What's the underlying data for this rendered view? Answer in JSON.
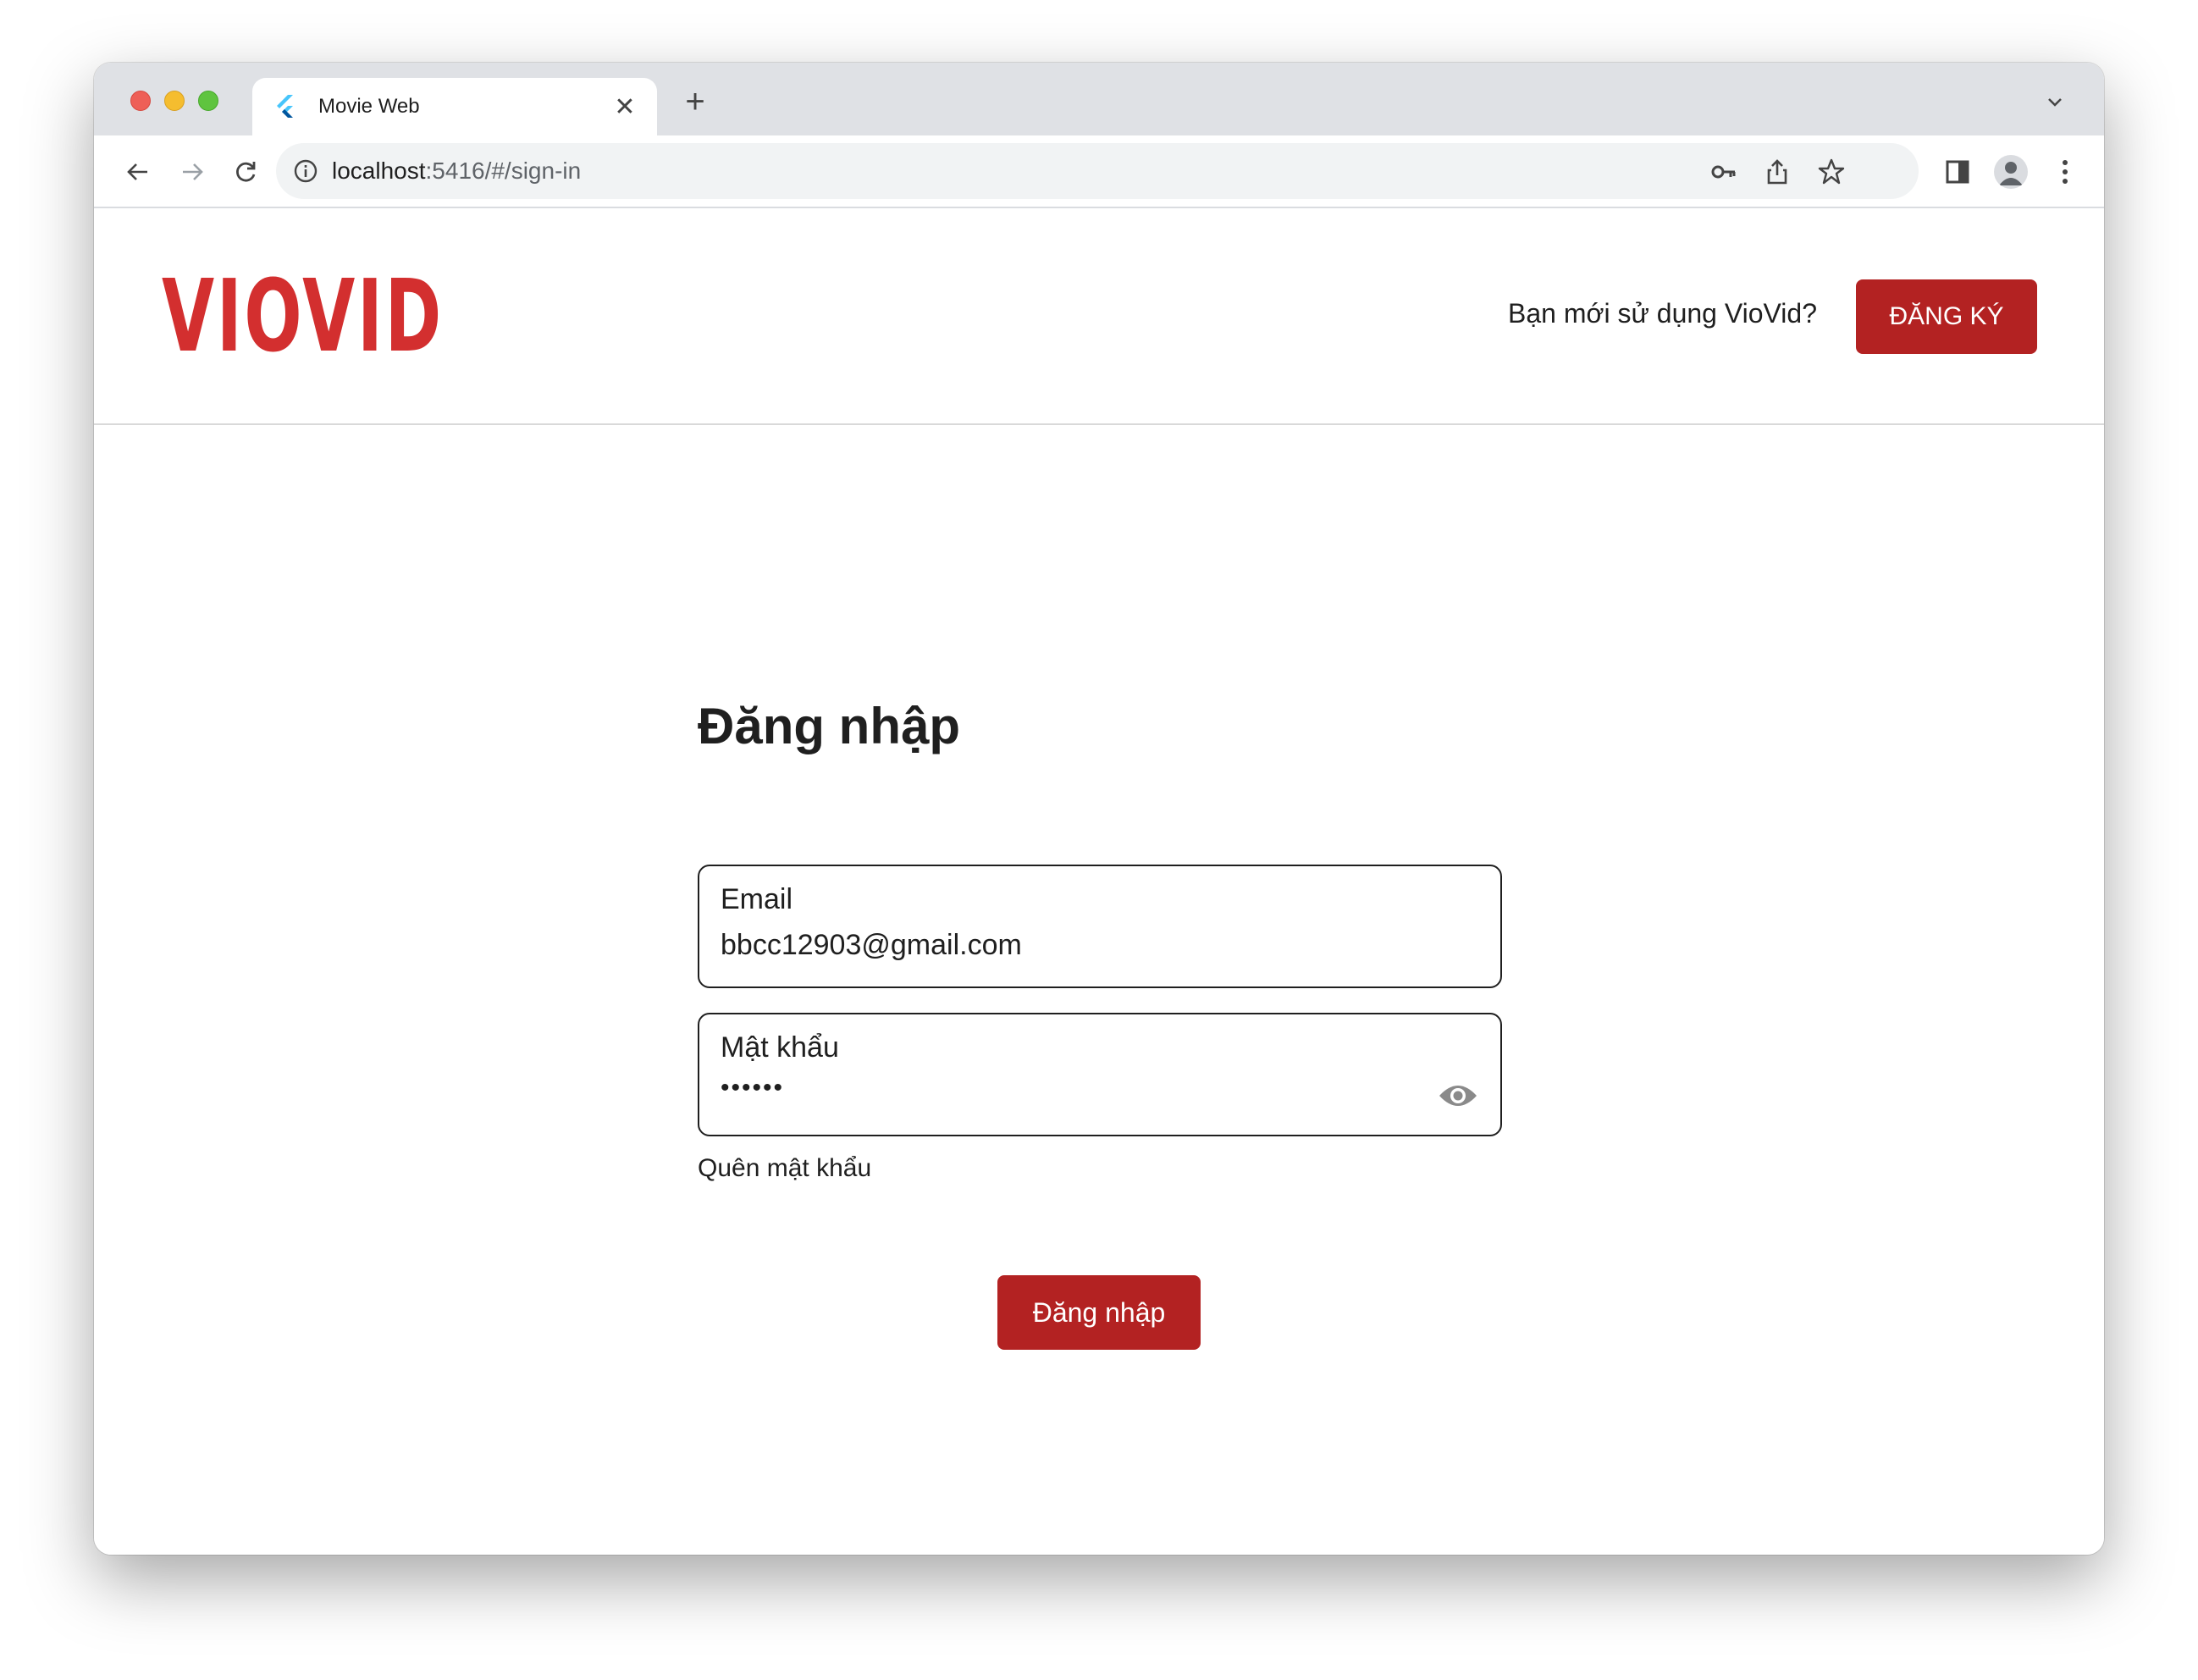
{
  "browser": {
    "tab": {
      "title": "Movie Web",
      "close_symbol": "✕"
    },
    "new_tab_symbol": "+",
    "address": {
      "host": "localhost",
      "rest": ":5416/#/sign-in"
    }
  },
  "site": {
    "logo_text": "VIOVID",
    "signup_prompt": "Bạn mới sử dụng VioVid?",
    "signup_button": "ĐĂNG KÝ"
  },
  "form": {
    "title": "Đăng nhập",
    "email": {
      "label": "Email",
      "value": "bbcc12903@gmail.com"
    },
    "password": {
      "label": "Mật khẩu",
      "value": "••••••"
    },
    "forgot_link": "Quên mật khẩu",
    "submit": "Đăng nhập"
  },
  "colors": {
    "brand_red": "#d32f2f",
    "button_red": "#b32222"
  }
}
